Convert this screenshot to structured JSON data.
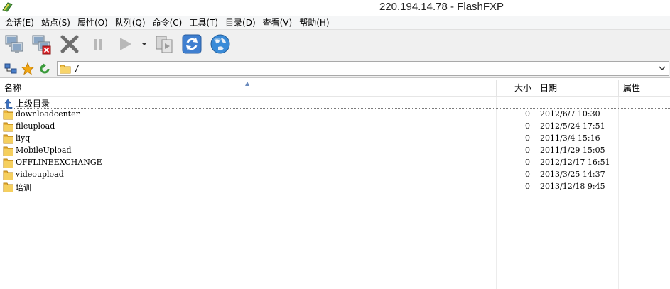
{
  "window": {
    "title": "220.194.14.78 - FlashFXP",
    "app_icon": "flashfxp-icon"
  },
  "menu": [
    {
      "label": "会话(E)"
    },
    {
      "label": "站点(S)"
    },
    {
      "label": "属性(O)"
    },
    {
      "label": "队列(Q)"
    },
    {
      "label": "命令(C)"
    },
    {
      "label": "工具(T)"
    },
    {
      "label": "目录(D)"
    },
    {
      "label": "查看(V)"
    },
    {
      "label": "帮助(H)"
    }
  ],
  "toolbar": {
    "buttons": [
      {
        "icon": "connect-icon"
      },
      {
        "icon": "disconnect-icon"
      },
      {
        "icon": "abort-icon"
      },
      {
        "icon": "pause-icon"
      },
      {
        "icon": "play-icon"
      },
      {
        "icon": "dropdown-arrow-icon"
      },
      {
        "icon": "transfer-icon"
      },
      {
        "icon": "refresh-icon"
      },
      {
        "icon": "globe-icon"
      }
    ]
  },
  "address": {
    "path": "/",
    "icons": [
      "tree-view-icon",
      "favorites-star-icon",
      "go-back-icon",
      "folder-icon",
      "chevron-down-icon"
    ]
  },
  "list": {
    "columns": {
      "name": "名称",
      "size": "大小",
      "date": "日期",
      "attr": "属性"
    },
    "parent_label": "上级目录",
    "rows": [
      {
        "name": "downloadcenter",
        "size": "0",
        "date": "2012/6/7 10:30"
      },
      {
        "name": "fileupload",
        "size": "0",
        "date": "2012/5/24 17:51"
      },
      {
        "name": "liyq",
        "size": "0",
        "date": "2011/3/4 15:16"
      },
      {
        "name": "MobileUpload",
        "size": "0",
        "date": "2011/1/29 15:05"
      },
      {
        "name": "OFFLINEEXCHANGE",
        "size": "0",
        "date": "2012/12/17 16:51"
      },
      {
        "name": "videoupload",
        "size": "0",
        "date": "2013/3/25 14:37"
      },
      {
        "name": "培训",
        "size": "0",
        "date": "2013/12/18 9:45"
      }
    ]
  }
}
